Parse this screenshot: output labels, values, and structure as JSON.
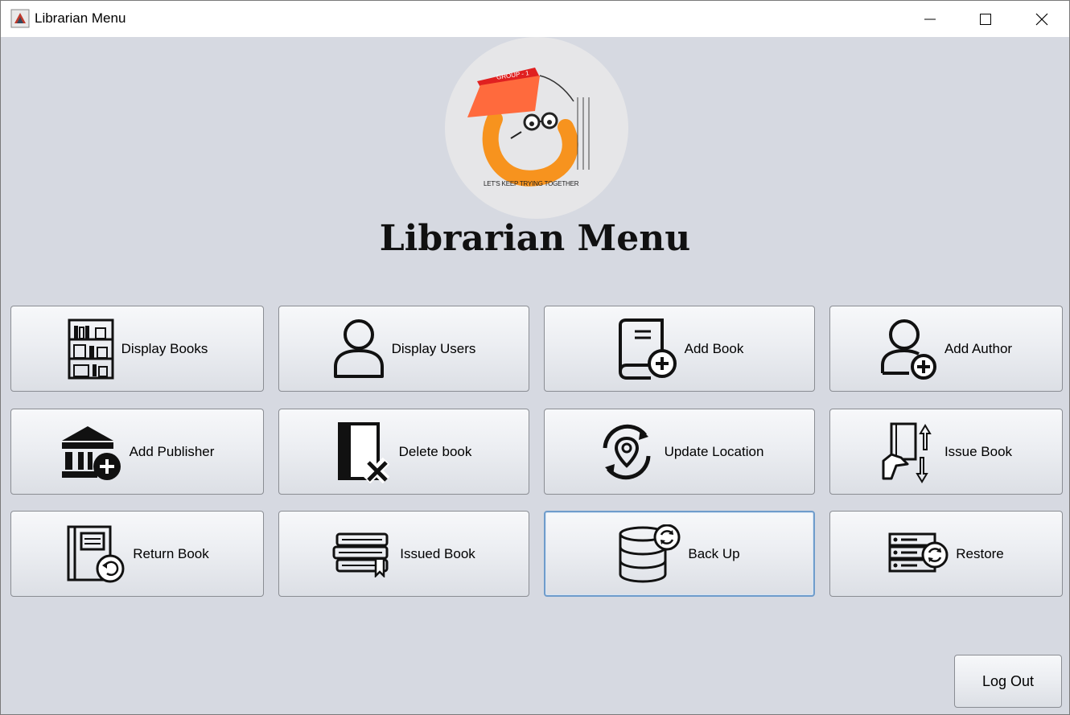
{
  "window": {
    "title": "Librarian Menu",
    "controls": [
      "minimize",
      "maximize",
      "close"
    ]
  },
  "logo": {
    "badge_text": "GROUP - 1",
    "slogan": "LET'S KEEP TRYING TOGETHER"
  },
  "heading": "Librarian Menu",
  "buttons": [
    {
      "label": "Display Books",
      "icon": "bookshelf-icon"
    },
    {
      "label": "Display Users",
      "icon": "user-icon"
    },
    {
      "label": "Add Book",
      "icon": "add-book-icon"
    },
    {
      "label": "Add Author",
      "icon": "add-author-icon"
    },
    {
      "label": "Add Publisher",
      "icon": "add-publisher-icon"
    },
    {
      "label": "Delete book",
      "icon": "delete-book-icon"
    },
    {
      "label": "Update Location",
      "icon": "update-location-icon"
    },
    {
      "label": "Issue Book",
      "icon": "issue-book-icon"
    },
    {
      "label": "Return Book",
      "icon": "return-book-icon"
    },
    {
      "label": "Issued Book",
      "icon": "issued-books-icon"
    },
    {
      "label": "Back Up",
      "icon": "database-backup-icon"
    },
    {
      "label": "Restore",
      "icon": "server-restore-icon"
    }
  ],
  "logout_label": "Log Out",
  "colors": {
    "background": "#d6d9e1",
    "focus_border": "#6f9ccb",
    "logo_orange": "#f7931e",
    "logo_red": "#e8492e"
  }
}
